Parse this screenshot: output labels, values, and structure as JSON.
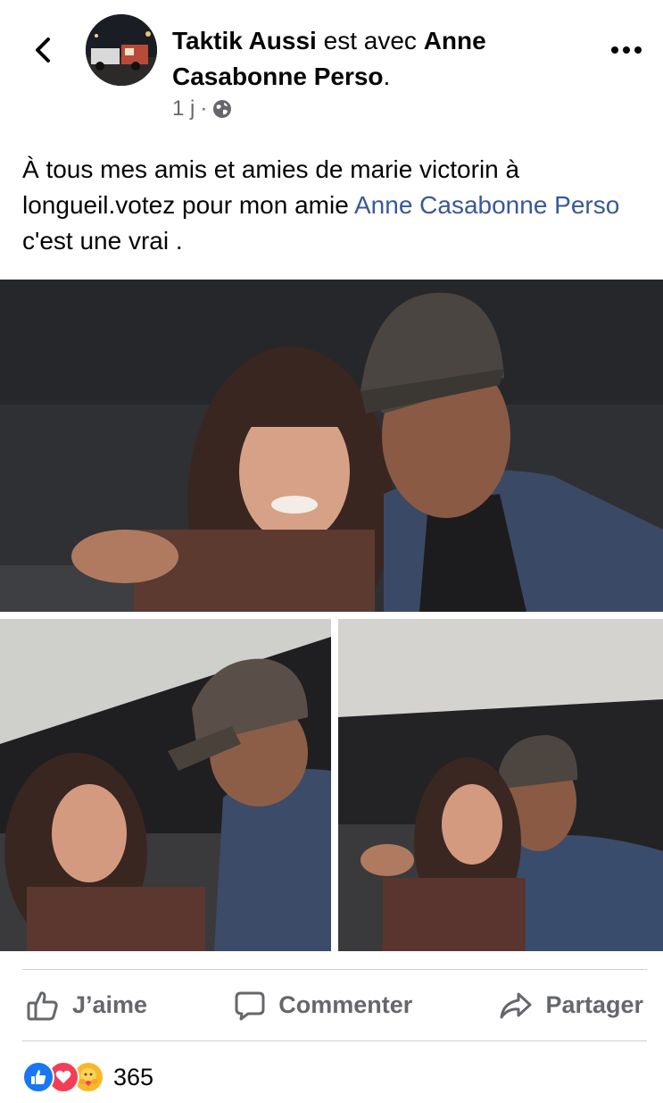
{
  "header": {
    "author": "Taktik Aussi",
    "with_text": "est avec",
    "tagged": "Anne Casabonne Perso",
    "tagged_suffix": ".",
    "timestamp": "1 j",
    "separator": "·",
    "privacy_icon": "globe-icon",
    "back_icon": "chevron-left-icon",
    "more_icon": "more-horizontal-icon"
  },
  "post": {
    "text_before": "À tous mes amis et amies de marie victorin à longueil.votez pour mon amie ",
    "mention": "Anne Casabonne Perso",
    "text_after": "  c'est une vrai ."
  },
  "photos": [
    {
      "name": "photo-main"
    },
    {
      "name": "photo-left"
    },
    {
      "name": "photo-right"
    }
  ],
  "actions": {
    "like": {
      "label": "J’aime",
      "icon": "thumbs-up-icon"
    },
    "comment": {
      "label": "Commenter",
      "icon": "comment-icon"
    },
    "share": {
      "label": "Partager",
      "icon": "share-icon"
    }
  },
  "reactions": {
    "types": [
      "like",
      "love",
      "care"
    ],
    "count": "365"
  },
  "colors": {
    "mention": "#385898",
    "secondary_text": "#65676b",
    "like_blue": "#1877f2",
    "love_red": "#f33e58",
    "care_yellow": "#f7b928"
  }
}
